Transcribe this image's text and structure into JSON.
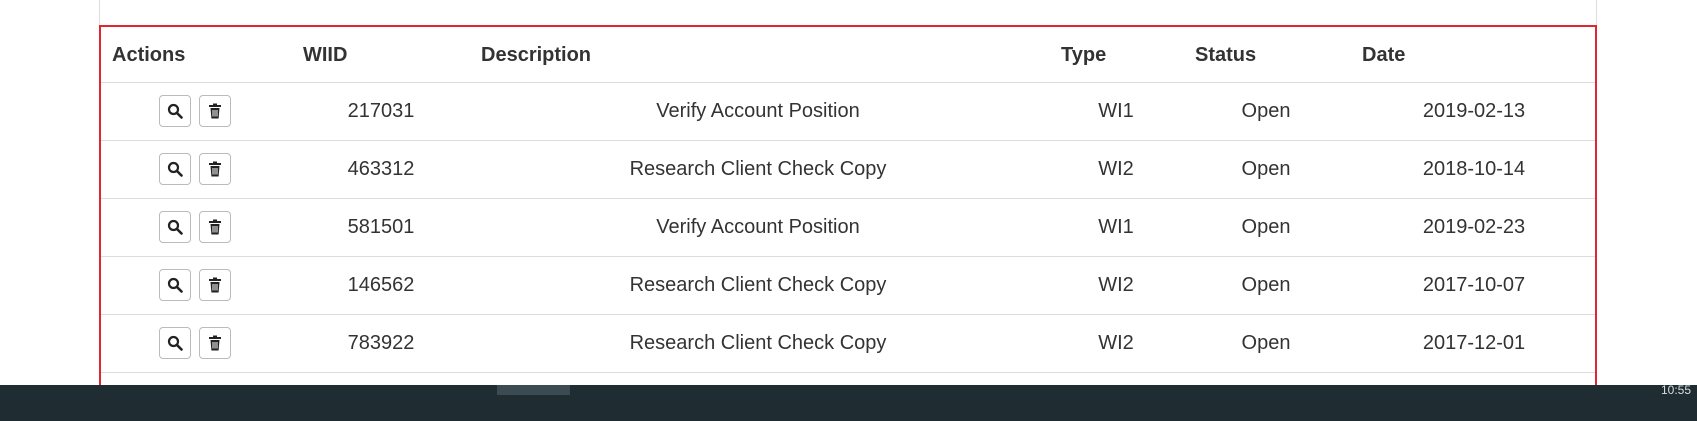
{
  "grid": {
    "columns": {
      "actions": "Actions",
      "wiid": "WIID",
      "description": "Description",
      "type": "Type",
      "status": "Status",
      "date": "Date"
    },
    "rows": [
      {
        "wiid": "217031",
        "description": "Verify Account Position",
        "type": "WI1",
        "status": "Open",
        "date": "2019-02-13"
      },
      {
        "wiid": "463312",
        "description": "Research Client Check Copy",
        "type": "WI2",
        "status": "Open",
        "date": "2018-10-14"
      },
      {
        "wiid": "581501",
        "description": "Verify Account Position",
        "type": "WI1",
        "status": "Open",
        "date": "2019-02-23"
      },
      {
        "wiid": "146562",
        "description": "Research Client Check Copy",
        "type": "WI2",
        "status": "Open",
        "date": "2017-10-07"
      },
      {
        "wiid": "783922",
        "description": "Research Client Check Copy",
        "type": "WI2",
        "status": "Open",
        "date": "2017-12-01"
      }
    ],
    "action_icons": [
      "search-icon",
      "trash-icon"
    ],
    "highlight_color": "#e0262e"
  },
  "taskbar": {
    "tray_text": "10:55"
  }
}
